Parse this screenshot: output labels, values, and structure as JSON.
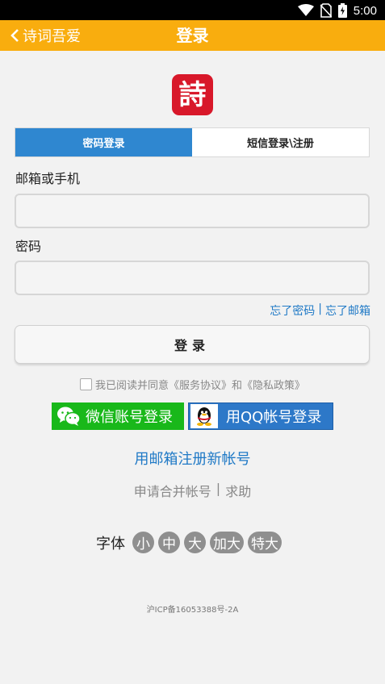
{
  "status_bar": {
    "time": "5:00"
  },
  "header": {
    "back_label": "诗词吾爱",
    "title": "登录"
  },
  "logo": {
    "glyph": "詩"
  },
  "tabs": [
    {
      "label": "密码登录",
      "active": true
    },
    {
      "label": "短信登录\\注册",
      "active": false
    }
  ],
  "form": {
    "account_label": "邮箱或手机",
    "account_value": "",
    "password_label": "密码",
    "password_value": ""
  },
  "forgot": {
    "password": "忘了密码",
    "separator": "|",
    "email": "忘了邮箱"
  },
  "login_button": "登录",
  "agreement": {
    "prefix": "我已阅读并同意",
    "service": "《服务协议》",
    "and": "和",
    "privacy": "《隐私政策》",
    "checked": false
  },
  "social": {
    "wechat": "微信账号登录",
    "qq": "用QQ帐号登录"
  },
  "register_link": "用邮箱注册新帐号",
  "merge": {
    "apply": "申请合并帐号",
    "separator": "|",
    "help": "求助"
  },
  "font_size": {
    "label": "字体",
    "options": [
      "小",
      "中",
      "大",
      "加大",
      "特大"
    ]
  },
  "icp": "沪ICP备16053388号-2A",
  "colors": {
    "header": "#f9ad0e",
    "tab_active": "#2f87d0",
    "link": "#1f79c6",
    "wechat": "#19b81a",
    "qq": "#2d78c8",
    "logo": "#d8182a"
  }
}
